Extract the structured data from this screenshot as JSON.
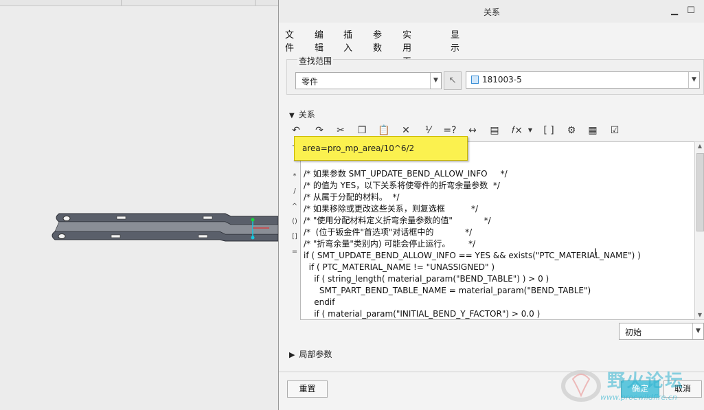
{
  "dialog": {
    "title": "关系",
    "menu": [
      "文件",
      "编辑",
      "插入",
      "参数",
      "实用工具",
      "显示"
    ],
    "scope_label": "查找范围",
    "scope_type": "零件",
    "scope_part": "181003-5",
    "relations_section": "关系",
    "tooltip": "area=pro_mp_area/10^6/2",
    "code_lines": [
      "/* 如果参数 SMT_UPDATE_BEND_ALLOW_INFO     */",
      "/* 的值为 YES，以下关系将使零件的折弯余量参数  */",
      "/* 从属于分配的材料。  */",
      "/* 如果移除或更改这些关系，则复选框          */",
      "/* \"使用分配材料定义折弯余量参数的值\"            */",
      "/*  (位于钣金件\"首选项\"对话框中的            */",
      "/* \"折弯余量\"类别内) 可能会停止运行。       */",
      "if ( SMT_UPDATE_BEND_ALLOW_INFO == YES && exists(\"PTC_MATERIAL_NAME\") )",
      "  if ( PTC_MATERIAL_NAME != \"UNASSIGNED\" )",
      "    if ( string_length( material_param(\"BEND_TABLE\") ) > 0 )",
      "      SMT_PART_BEND_TABLE_NAME = material_param(\"BEND_TABLE\")",
      "    endif",
      "    if ( material_param(\"INITIAL_BEND_Y_FACTOR\") > 0.0 )"
    ],
    "sidebar_ops": [
      "+",
      "-",
      "*",
      "/",
      "^",
      "()",
      "[]",
      "="
    ],
    "state_select": "初始",
    "local_params": "局部参数",
    "buttons": {
      "reset": "重置",
      "ok": "确定",
      "cancel": "取消"
    }
  },
  "watermark": {
    "text": "野火论坛",
    "url": "www.proewildfire.cn"
  },
  "colors": {
    "tooltip_bg": "#fbf14f",
    "part": "#5a5f6a",
    "watermark": "#2fb3cf"
  }
}
